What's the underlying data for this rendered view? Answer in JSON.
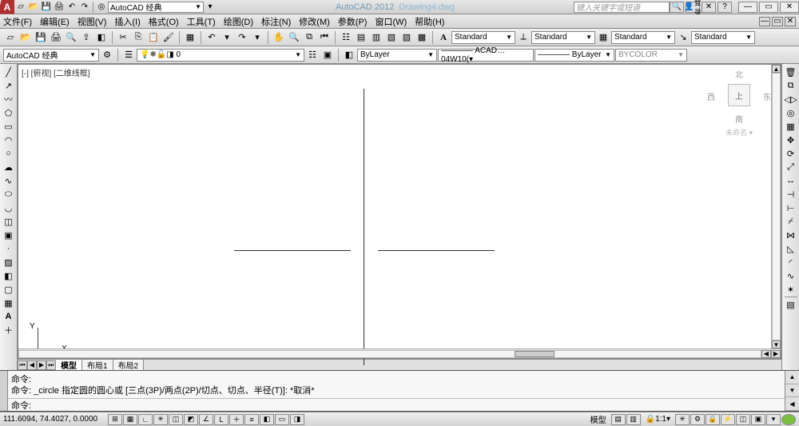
{
  "title": {
    "app": "AutoCAD 2012",
    "doc": "Drawing4.dwg"
  },
  "workspace": "AutoCAD 经典",
  "search_placeholder": "键入关键字或短语",
  "login": "登录",
  "menu": {
    "file": "文件(F)",
    "edit": "编辑(E)",
    "view": "视图(V)",
    "insert": "插入(I)",
    "format": "格式(O)",
    "tools": "工具(T)",
    "draw": "绘图(D)",
    "dimension": "标注(N)",
    "modify": "修改(M)",
    "parametric": "参数(P)",
    "window": "窗口(W)",
    "help": "帮助(H)"
  },
  "styles": {
    "text": "Standard",
    "dim": "Standard",
    "table": "Standard",
    "mleader": "Standard"
  },
  "layer": {
    "current": "0",
    "wssel": "AutoCAD 经典"
  },
  "props": {
    "color": "ByLayer",
    "ltype": "———— ACAD…04W10(▾",
    "lweight": "———— ByLayer",
    "plotstyle": "BYCOLOR"
  },
  "viewport": {
    "label": "[-] [俯视] [二维线框]"
  },
  "ucs": {
    "x": "X",
    "y": "Y"
  },
  "viewcube": {
    "n": "北",
    "s": "南",
    "w": "西",
    "e": "东",
    "top": "上",
    "wcs": "未命名 ▾"
  },
  "tabs": {
    "model": "模型",
    "layout1": "布局1",
    "layout2": "布局2"
  },
  "cmd": {
    "h1": "命令:",
    "h2": "命令: _circle 指定圆的圆心或 [三点(3P)/两点(2P)/切点、切点、半径(T)]: *取消*",
    "prompt": "命令:"
  },
  "status": {
    "coord": "111.6094, 74.4027, 0.0000",
    "model": "模型",
    "scale": "1:1"
  }
}
